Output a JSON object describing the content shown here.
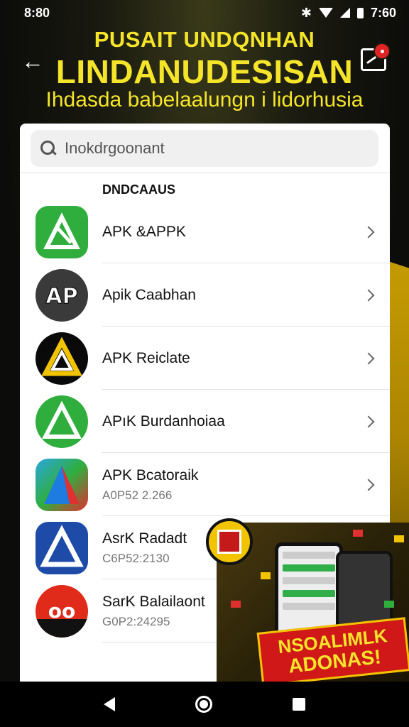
{
  "status_bar": {
    "time_left": "8:80",
    "time_right": "7:60",
    "bluetooth_icon": "bluetooth-icon"
  },
  "header": {
    "line1": "PUSAIT UNDQNHAN",
    "line2": "LINDANUDESISAN",
    "line3": "Ihdasda babelaalungn i lidorhusia",
    "accent_color": "#f4e42a"
  },
  "search": {
    "placeholder": "Inokdrgoonant"
  },
  "section": {
    "label": "DNDCAAUS"
  },
  "apps": [
    {
      "name": "APK &APPK",
      "sub": ""
    },
    {
      "name": "Apik Caabhan",
      "sub": ""
    },
    {
      "name": "APK Reiclate",
      "sub": ""
    },
    {
      "name": "APıK Burdanhoiaa",
      "sub": ""
    },
    {
      "name": "APK Bcatoraik",
      "sub": "A0P52 2.266"
    },
    {
      "name": "AsrK Radadt",
      "sub": "C6P52:2130"
    },
    {
      "name": "SarK Balailaont",
      "sub": "G0P2:24295"
    }
  ],
  "promo": {
    "line1": "NSOALIMLK",
    "line2": "ADONAS!"
  },
  "colors": {
    "promo_red": "#d01818",
    "promo_yellow": "#f2c400"
  }
}
